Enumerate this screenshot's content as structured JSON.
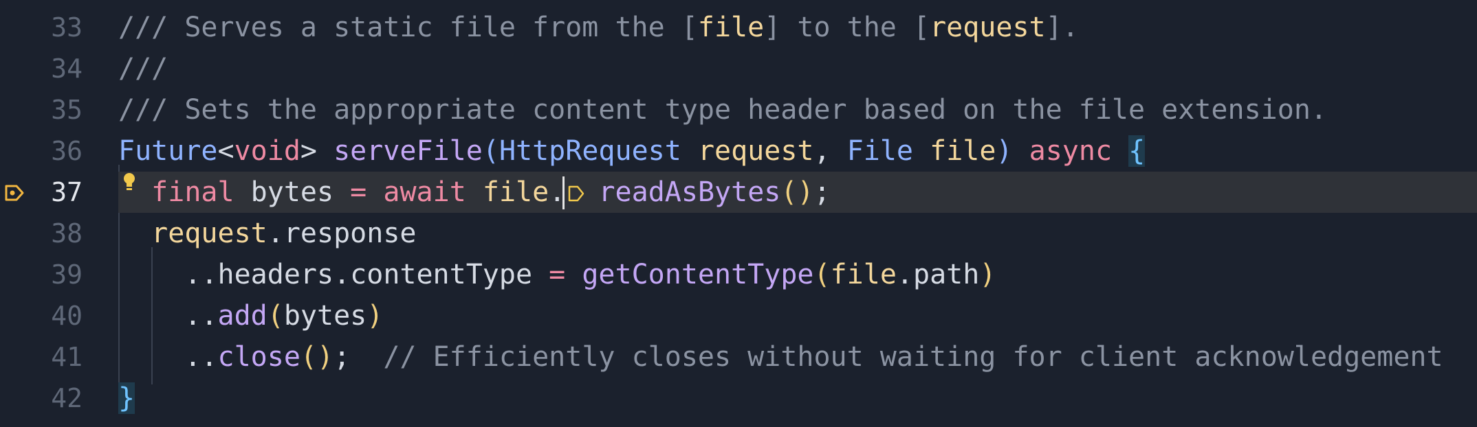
{
  "editor": {
    "current_line": "37",
    "lines": [
      {
        "number": "33",
        "tokens": [
          {
            "t": "/// Serves a static file from the ",
            "c": "cmt"
          },
          {
            "t": "[",
            "c": "cmt"
          },
          {
            "t": "file",
            "c": "ref"
          },
          {
            "t": "]",
            "c": "cmt"
          },
          {
            "t": " to the ",
            "c": "cmt"
          },
          {
            "t": "[",
            "c": "cmt"
          },
          {
            "t": "request",
            "c": "ref"
          },
          {
            "t": "]",
            "c": "cmt"
          },
          {
            "t": ".",
            "c": "cmt"
          }
        ]
      },
      {
        "number": "34",
        "tokens": [
          {
            "t": "///",
            "c": "cmt"
          }
        ]
      },
      {
        "number": "35",
        "tokens": [
          {
            "t": "/// Sets the appropriate content type header based on the file extension.",
            "c": "cmt"
          }
        ]
      },
      {
        "number": "36",
        "tokens": [
          {
            "t": "Future",
            "c": "type"
          },
          {
            "t": "<",
            "c": "punc"
          },
          {
            "t": "void",
            "c": "kw"
          },
          {
            "t": "> ",
            "c": "punc"
          },
          {
            "t": "serveFile",
            "c": "fn"
          },
          {
            "t": "(",
            "c": "type"
          },
          {
            "t": "HttpRequest",
            "c": "type"
          },
          {
            "t": " ",
            "c": "plain"
          },
          {
            "t": "request",
            "c": "param"
          },
          {
            "t": ", ",
            "c": "punc"
          },
          {
            "t": "File",
            "c": "type"
          },
          {
            "t": " ",
            "c": "plain"
          },
          {
            "t": "file",
            "c": "param"
          },
          {
            "t": ")",
            "c": "type"
          },
          {
            "t": " ",
            "c": "plain"
          },
          {
            "t": "async",
            "c": "kw"
          },
          {
            "t": " ",
            "c": "plain"
          },
          {
            "t": "{",
            "c": "brace-hl"
          }
        ]
      },
      {
        "number": "37",
        "tokens": [
          {
            "t": "  ",
            "c": "plain"
          },
          {
            "t": "final",
            "c": "kw"
          },
          {
            "t": " bytes ",
            "c": "plain"
          },
          {
            "t": "=",
            "c": "kw"
          },
          {
            "t": " ",
            "c": "plain"
          },
          {
            "t": "await",
            "c": "kw"
          },
          {
            "t": " ",
            "c": "plain"
          },
          {
            "t": "file",
            "c": "param"
          },
          {
            "t": ".",
            "c": "punc"
          },
          {
            "t": "  ",
            "c": "plain"
          },
          {
            "t": "readAsBytes",
            "c": "fn"
          },
          {
            "t": "()",
            "c": "paren"
          },
          {
            "t": ";",
            "c": "punc"
          }
        ]
      },
      {
        "number": "38",
        "tokens": [
          {
            "t": "  ",
            "c": "plain"
          },
          {
            "t": "request",
            "c": "param"
          },
          {
            "t": ".response",
            "c": "plain"
          }
        ]
      },
      {
        "number": "39",
        "tokens": [
          {
            "t": "    ..headers.contentType ",
            "c": "plain"
          },
          {
            "t": "=",
            "c": "kw"
          },
          {
            "t": " ",
            "c": "plain"
          },
          {
            "t": "getContentType",
            "c": "fn"
          },
          {
            "t": "(",
            "c": "paren"
          },
          {
            "t": "file",
            "c": "param"
          },
          {
            "t": ".path",
            "c": "plain"
          },
          {
            "t": ")",
            "c": "paren"
          }
        ]
      },
      {
        "number": "40",
        "tokens": [
          {
            "t": "    ..",
            "c": "plain"
          },
          {
            "t": "add",
            "c": "fn"
          },
          {
            "t": "(",
            "c": "paren"
          },
          {
            "t": "bytes",
            "c": "plain"
          },
          {
            "t": ")",
            "c": "paren"
          }
        ]
      },
      {
        "number": "41",
        "tokens": [
          {
            "t": "    ..",
            "c": "plain"
          },
          {
            "t": "close",
            "c": "fn"
          },
          {
            "t": "()",
            "c": "paren"
          },
          {
            "t": ";  ",
            "c": "punc"
          },
          {
            "t": "// Efficiently closes without waiting for client acknowledgement",
            "c": "cmt"
          }
        ]
      },
      {
        "number": "42",
        "tokens": [
          {
            "t": "}",
            "c": "brace-hl"
          }
        ]
      }
    ]
  },
  "icons": {
    "breakpoint": "execution-point-icon",
    "intention": "lightbulb-icon",
    "inlay": "inlay-hint-icon"
  },
  "colors": {
    "background": "#1b212d",
    "active_line": "#2f3238",
    "breakpoint": "#f2b640",
    "bulb": "#f2c94c"
  }
}
